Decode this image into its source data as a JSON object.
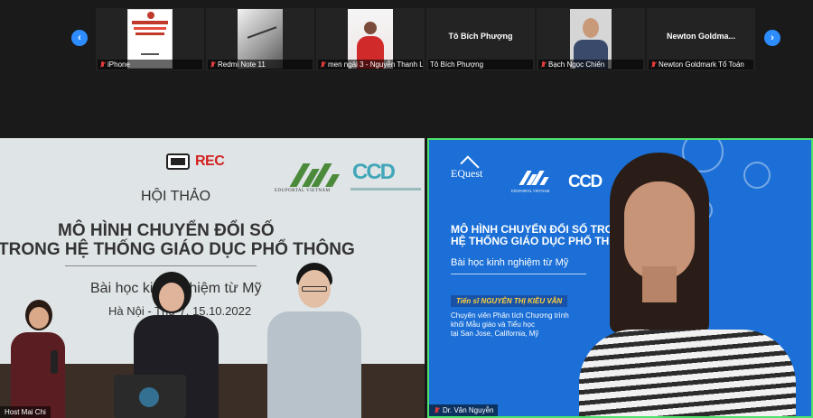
{
  "strip": {
    "prev_label": "‹",
    "next_label": "›",
    "participants": [
      {
        "name": "iPhone",
        "pic": "doc",
        "display_name": "",
        "muted": true
      },
      {
        "name": "Redmi Note 11",
        "pic": "tablet",
        "display_name": "",
        "muted": true
      },
      {
        "name": "men ngải 3 - Nguyễn Thanh L...",
        "pic": "woman",
        "display_name": "",
        "muted": true
      },
      {
        "name": "Tô Bích Phượng",
        "pic": "",
        "display_name": "Tô Bích Phượng",
        "muted": false
      },
      {
        "name": "Bạch Ngọc Chiến",
        "pic": "man",
        "display_name": "",
        "muted": true
      },
      {
        "name": "Newton Goldmark Tổ Toán",
        "pic": "",
        "display_name": "Newton  Goldma...",
        "muted": true
      }
    ],
    "doc_thumb": {
      "lines": [
        "GIÁ ĐỔI DƯỠNG TẬP H",
        "ỨNG DỤNG CNTT VÀ TRUY",
        "ỊN TRƯỜNG TIỂU HỌC",
        "Hà Nội, 12/2021"
      ]
    }
  },
  "left_panel": {
    "rec": "REC",
    "edu_label": "EDUPORTAL VIETNAM",
    "ccd": "CCD",
    "hoi_thao": "HỘI THẢO",
    "title_line1": "MÔ HÌNH CHUYỂN ĐỔI SỐ",
    "title_line2": "TRONG HỆ THỐNG GIÁO DỤC PHỔ THÔNG",
    "subtitle": "Bài học kinh nghiệm từ Mỹ",
    "date": "Hà Nội - Thứ 7, 15.10.2022",
    "name_tag": "Host Mai Chi"
  },
  "right_panel": {
    "equest": "EQuest",
    "edu_label": "EDUPORTAL VIETNAM",
    "ccd": "CCD",
    "title_line1": "MÔ HÌNH CHUYỂN ĐỔI SỐ TRONG",
    "title_line2": "HỆ THỐNG GIÁO DỤC PHỔ THÔNG",
    "subtitle": "Bài học kinh nghiệm từ Mỹ",
    "badge": "Tiến sĩ NGUYỄN THỊ KIỀU VÂN",
    "desc_1": "Chuyên viên Phân tích Chương trình",
    "desc_2": "khối Mẫu giáo và Tiểu học",
    "desc_3": "tại San Jose, California, Mỹ",
    "name_tag": "Dr. Vân Nguyễn"
  },
  "colors": {
    "accent": "#2d8cff",
    "active_border": "#4ee36a",
    "muted": "#e03b3b",
    "rec": "#d42020"
  }
}
